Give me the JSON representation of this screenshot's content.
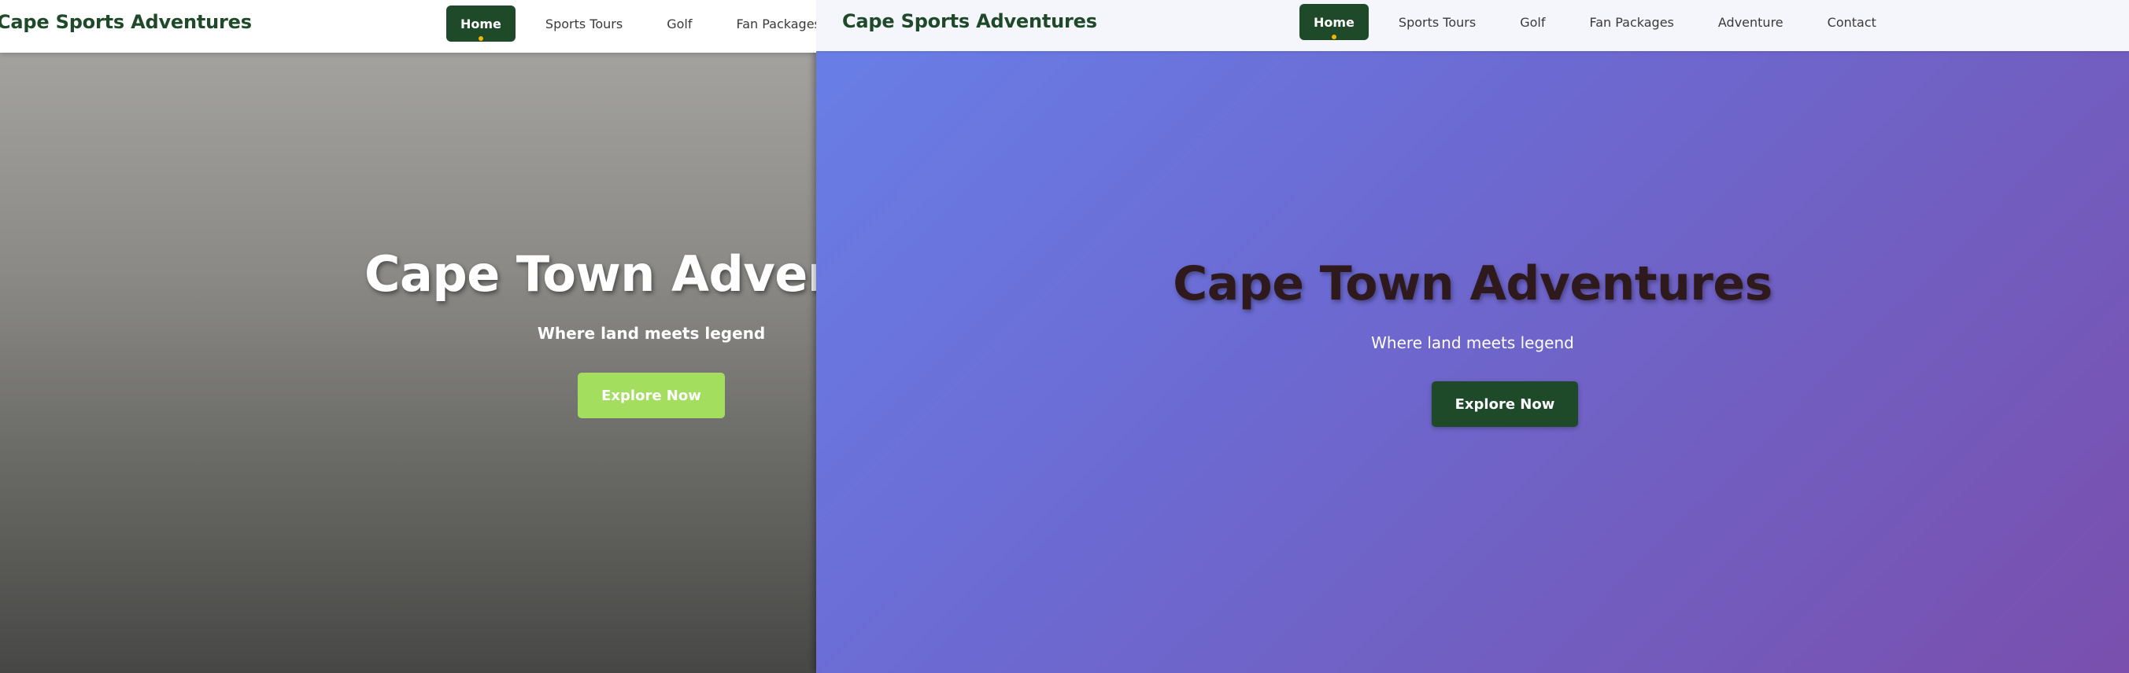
{
  "colors": {
    "brand_green": "#1f4a2a",
    "accent_dot": "#f2b705",
    "left_cta": "#a3de5f",
    "right_gradient_start": "#6880e8",
    "right_gradient_end": "#7a4fae"
  },
  "left": {
    "brand": "Cape Sports Adventures",
    "nav": [
      "Home",
      "Sports Tours",
      "Golf",
      "Fan Packages"
    ],
    "hero": {
      "title": "Cape Town Adventures",
      "subtitle": "Where land meets legend",
      "cta": "Explore Now"
    }
  },
  "right": {
    "brand": "Cape Sports Adventures",
    "nav": [
      "Home",
      "Sports Tours",
      "Golf",
      "Fan Packages",
      "Adventure",
      "Contact"
    ],
    "hero": {
      "title": "Cape Town Adventures",
      "subtitle": "Where land meets legend",
      "cta": "Explore Now"
    }
  }
}
